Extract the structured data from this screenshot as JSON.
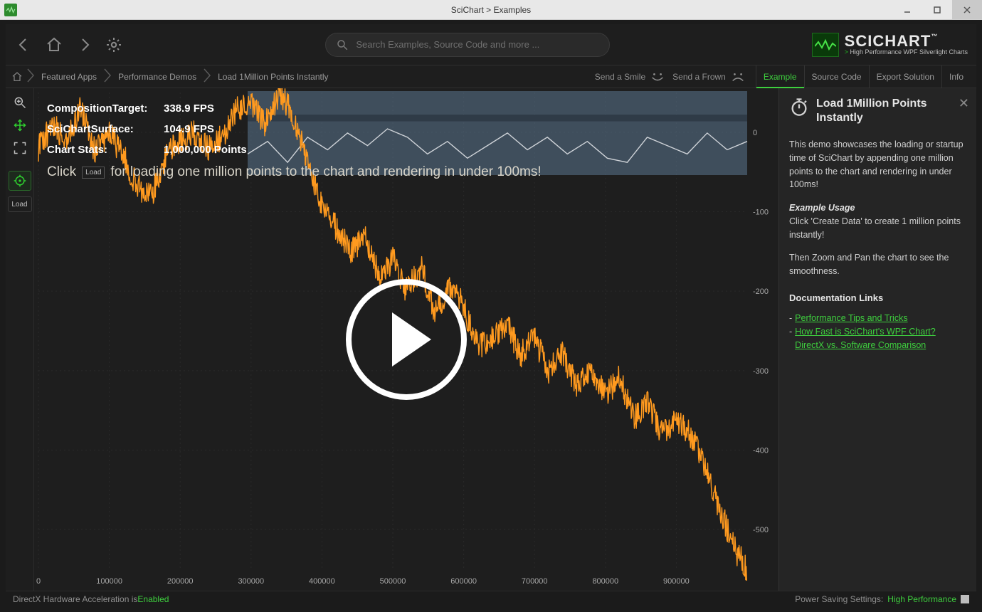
{
  "window": {
    "title": "SciChart > Examples"
  },
  "toolbar": {
    "search_placeholder": "Search Examples, Source Code and more ...",
    "brand_name": "SCICHART",
    "brand_tm": "™",
    "brand_sub_prefix": "> ",
    "brand_sub": "High Performance WPF Silverlight Charts"
  },
  "breadcrumbs": [
    "Featured Apps",
    "Performance Demos",
    "Load 1Million Points Instantly"
  ],
  "feedback": {
    "smile": "Send a Smile",
    "frown": "Send a Frown"
  },
  "tabs": {
    "items": [
      "Example",
      "Source Code",
      "Export Solution",
      "Info"
    ],
    "active": 0
  },
  "left_tools": {
    "load_label": "Load"
  },
  "stats": {
    "rows": [
      {
        "label": "CompositionTarget:",
        "value": "338.9 FPS"
      },
      {
        "label": "SciChartSurface:",
        "value": "104.9 FPS"
      },
      {
        "label": "Chart Stats:",
        "value": "1,000,000 Points"
      }
    ],
    "hint_before": "Click",
    "hint_button": "Load",
    "hint_after": "for loading one million points to the chart and rendering in under 100ms!"
  },
  "info_panel": {
    "title": "Load 1Million Points Instantly",
    "p1": "This demo showcases the loading or startup time of SciChart by appending one million points to the chart and rendering in under 100ms!",
    "usage_heading": "Example Usage",
    "usage_p1": "Click 'Create Data' to create 1 million points instantly!",
    "usage_p2": "Then Zoom and Pan the chart to see the smoothness.",
    "docs_heading": "Documentation Links",
    "links": [
      "Performance Tips and Tricks",
      "How Fast is SciChart's WPF Chart? DirectX vs. Software Comparison"
    ]
  },
  "status": {
    "left_prefix": "DirectX Hardware Acceleration is ",
    "left_value": "Enabled",
    "right_prefix": "Power Saving Settings: ",
    "right_value": "High Performance"
  },
  "chart_data": {
    "type": "line",
    "title": "",
    "xlabel": "",
    "ylabel": "",
    "xlim": [
      0,
      1000000
    ],
    "ylim": [
      -550,
      50
    ],
    "x_ticks": [
      0,
      100000,
      200000,
      300000,
      400000,
      500000,
      600000,
      700000,
      800000,
      900000
    ],
    "y_ticks": [
      0,
      -100,
      -200,
      -300,
      -400,
      -500
    ],
    "series": [
      {
        "name": "random-walk",
        "color": "#ff9a1f",
        "x": [
          0,
          20000,
          40000,
          60000,
          80000,
          100000,
          120000,
          140000,
          160000,
          180000,
          200000,
          220000,
          240000,
          260000,
          280000,
          300000,
          320000,
          340000,
          360000,
          380000,
          400000,
          420000,
          440000,
          460000,
          480000,
          500000,
          520000,
          540000,
          560000,
          580000,
          600000,
          620000,
          640000,
          660000,
          680000,
          700000,
          720000,
          740000,
          760000,
          780000,
          800000,
          820000,
          840000,
          860000,
          880000,
          900000,
          920000,
          940000,
          960000,
          980000,
          1000000
        ],
        "y": [
          -20,
          10,
          -10,
          30,
          -25,
          0,
          -30,
          -70,
          -80,
          -30,
          -10,
          0,
          -20,
          -5,
          30,
          40,
          10,
          50,
          20,
          -40,
          -90,
          -120,
          -150,
          -130,
          -180,
          -160,
          -200,
          -170,
          -230,
          -190,
          -220,
          -270,
          -260,
          -240,
          -280,
          -260,
          -300,
          -280,
          -320,
          -300,
          -330,
          -310,
          -360,
          -340,
          -380,
          -360,
          -380,
          -420,
          -470,
          -520,
          -550
        ]
      }
    ],
    "overview": {
      "range": [
        0,
        1000000
      ],
      "series_y": [
        20,
        35,
        10,
        40,
        25,
        45,
        30,
        50,
        40,
        20,
        35,
        15,
        30,
        45,
        25,
        40,
        20,
        35,
        15,
        10,
        40,
        30,
        20,
        45,
        25,
        35
      ],
      "series_color": "#cfd3d8",
      "band_color": "#5b7690"
    }
  }
}
